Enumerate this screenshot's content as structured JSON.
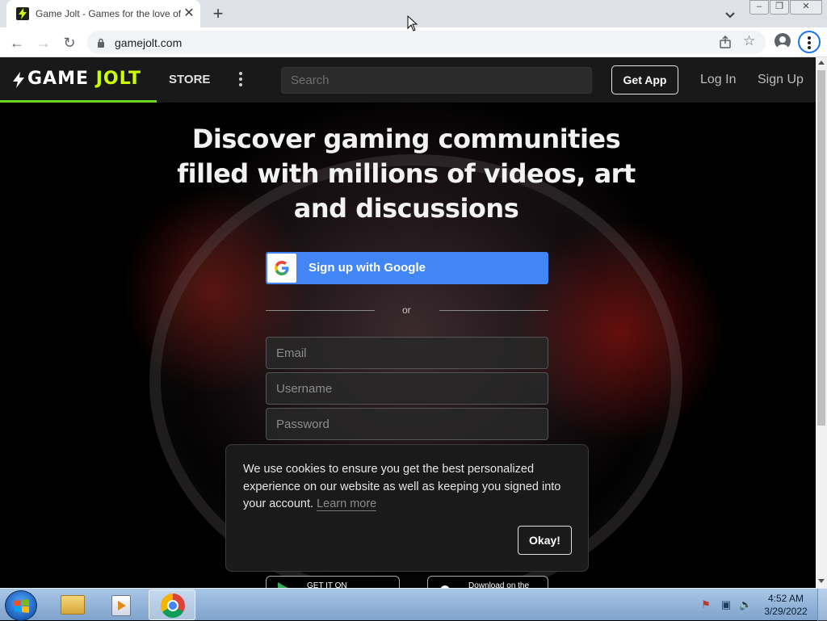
{
  "browser": {
    "tab_title": "Game Jolt - Games for the love of it",
    "new_tab_symbol": "+",
    "url": "gamejolt.com"
  },
  "site": {
    "logo": {
      "word1": "GAME",
      "word2": "JOLT"
    },
    "store_label": "STORE",
    "search_placeholder": "Search",
    "get_app_label": "Get App",
    "login_label": "Log In",
    "signup_label": "Sign Up",
    "accent_color": "#ccff00",
    "accent_bar_color": "#6bd425"
  },
  "hero": {
    "title": "Discover gaming communities filled with millions of videos, art and discussions"
  },
  "signup": {
    "google_label": "Sign up with Google",
    "google_color": "#4285f4",
    "or_label": "or",
    "email_placeholder": "Email",
    "username_placeholder": "Username",
    "password_placeholder": "Password"
  },
  "badges": {
    "google_play": "GET IT ON",
    "app_store": "Download on the"
  },
  "cookie": {
    "text": "We use cookies to ensure you get the best personalized experience on our website as well as keeping you signed into your account.",
    "link_label": "Learn more",
    "ok_label": "Okay!"
  },
  "taskbar": {
    "time": "4:52 AM",
    "date": "3/29/2022"
  },
  "icons": [
    "game-jolt-favicon",
    "close-icon",
    "chevron-down-icon",
    "back-arrow-icon",
    "forward-arrow-icon",
    "reload-icon",
    "lock-icon",
    "share-icon",
    "star-icon",
    "profile-icon",
    "kebab-menu-icon",
    "lightning-bolt-icon",
    "google-g-icon",
    "windows-start-icon",
    "folder-icon",
    "media-player-icon",
    "chrome-icon",
    "flag-icon",
    "network-icon",
    "volume-icon"
  ]
}
